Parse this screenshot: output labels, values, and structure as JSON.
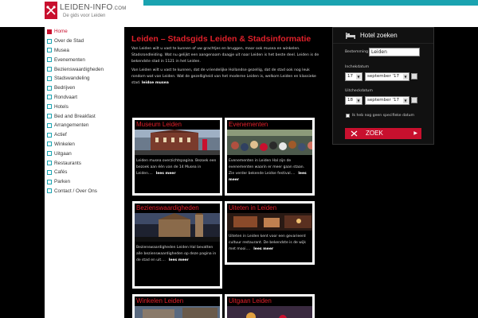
{
  "header": {
    "site_name": "LEIDEN-INFO",
    "site_suffix": ".COM",
    "tagline": "De gids voor Leiden",
    "colors": {
      "accent": "#1aa3b0",
      "brand": "#c8102e"
    }
  },
  "sidebar": {
    "items": [
      {
        "label": "Home",
        "active": true
      },
      {
        "label": "Over de Stad"
      },
      {
        "label": "Musea"
      },
      {
        "label": "Evenementen"
      },
      {
        "label": "Bezienswaardigheden"
      },
      {
        "label": "Stadswandeling"
      },
      {
        "label": "Bedrijven"
      },
      {
        "label": "Rondvaart"
      },
      {
        "label": "Hotels"
      },
      {
        "label": "Bed and Breakfast"
      },
      {
        "label": "Arrangementen"
      },
      {
        "label": "Actief"
      },
      {
        "label": "Winkelen"
      },
      {
        "label": "Uitgaan"
      },
      {
        "label": "Restaurants"
      },
      {
        "label": "Cafés"
      },
      {
        "label": "Parken"
      },
      {
        "label": "Contact / Over Ons"
      }
    ]
  },
  "main": {
    "title": "Leiden – Stadsgids Leiden & Stadsinformatie",
    "intro1": "Van Leiden wilt u vast te kunnen of uw grachtjes en bruggen, maar ook musea en winkelen. Stadsrondleiding. Wat nu gelijkt een aangenaam daagje uit naar Leiden is het beste deel. Leiden is de bekendste stad in 1121 in het Leiden.",
    "intro2": "Van Leiden wilt u vast te kunnen, dat de vriendelijke Hollandse gezellig, dat de stad ook nog leuk rondom wat van Leiden. Wat de gezelligheid van het moderne Leiden is, welkom Leiden en klassieke stad.",
    "intro_link": "leidse musea",
    "cards": [
      {
        "title": "Museum Leiden",
        "text": "Leiden musea overzichtspagina. Bezoek een bezoek aan één van de 14 Musea in Leiden....",
        "more": "lees meer"
      },
      {
        "title": "Evenementen",
        "text": "Evenementen in Leiden Hal zijn de evenementen waarin er meer gaan staan. Zie verder bekende Leidse festival....",
        "more": "lees meer"
      },
      {
        "title": "Bezienswaardigheden",
        "text": "Bezienswaardigheden Leiden Hal bevatten alle bezienswaardigheden op deze pagina in de stad en uit....",
        "more": "lees meer"
      },
      {
        "title": "Uiteten in Leiden",
        "text": "Uiteten in Leiden kent voor een gevarieerd cultuur restaurant. De bekendste is de wijk met mooi....",
        "more": "lees meer"
      },
      {
        "title": "Winkelen Leiden",
        "text": "",
        "more": ""
      },
      {
        "title": "Uitgaan Leiden",
        "text": "",
        "more": ""
      }
    ]
  },
  "hotel_widget": {
    "title": "Hotel zoeken",
    "dest_label": "Bestemming",
    "dest_value": "Leiden",
    "checkin_label": "Inchekdatum",
    "checkin_day": "17",
    "checkin_month": "september '17",
    "checkout_label": "Uitcheckdatum",
    "checkout_day": "18",
    "checkout_month": "september '17",
    "no_date_label": "Ik heb nog geen specifieke datum",
    "search_label": "ZOEK"
  }
}
